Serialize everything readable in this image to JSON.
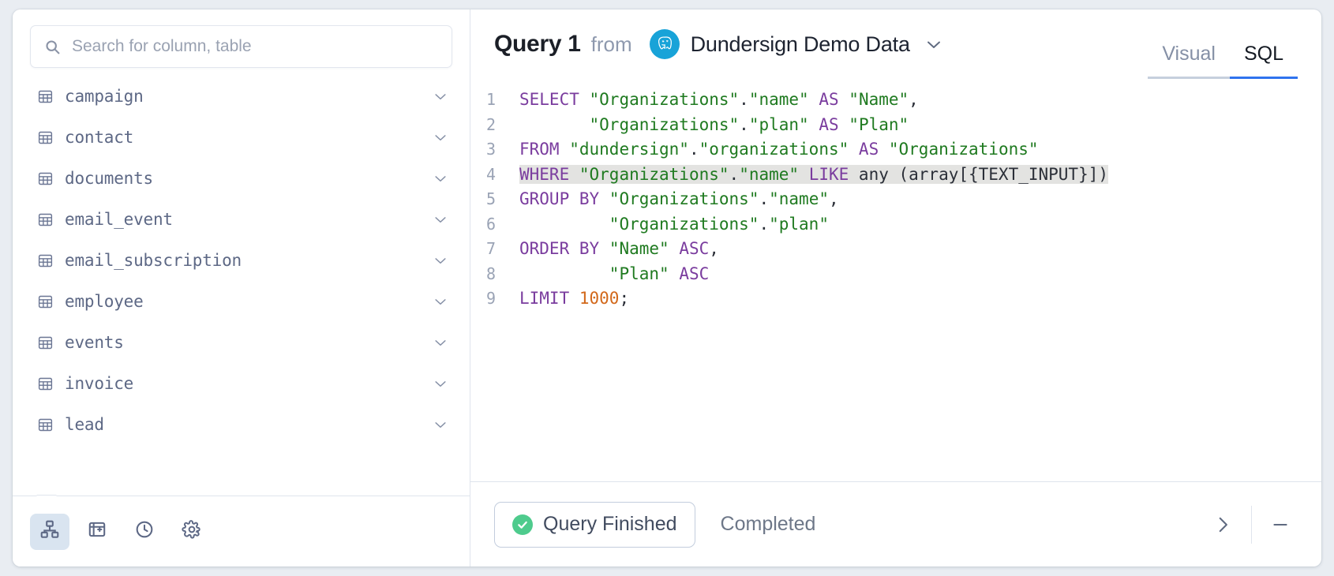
{
  "sidebar": {
    "search": {
      "placeholder": "Search for column, table",
      "value": "",
      "icon": "search-icon"
    },
    "tables": [
      {
        "name": "campaign",
        "icon": "table-icon",
        "expand_icon": "chevron-down-icon"
      },
      {
        "name": "contact",
        "icon": "table-icon",
        "expand_icon": "chevron-down-icon"
      },
      {
        "name": "documents",
        "icon": "table-icon",
        "expand_icon": "chevron-down-icon"
      },
      {
        "name": "email_event",
        "icon": "table-icon",
        "expand_icon": "chevron-down-icon"
      },
      {
        "name": "email_subscription",
        "icon": "table-icon",
        "expand_icon": "chevron-down-icon"
      },
      {
        "name": "employee",
        "icon": "table-icon",
        "expand_icon": "chevron-down-icon"
      },
      {
        "name": "events",
        "icon": "table-icon",
        "expand_icon": "chevron-down-icon"
      },
      {
        "name": "invoice",
        "icon": "table-icon",
        "expand_icon": "chevron-down-icon"
      },
      {
        "name": "lead",
        "icon": "table-icon",
        "expand_icon": "chevron-down-icon"
      }
    ],
    "footer_buttons": [
      {
        "icon": "data-model-icon",
        "active": true
      },
      {
        "icon": "notebook-icon",
        "active": false
      },
      {
        "icon": "history-clock-icon",
        "active": false
      },
      {
        "icon": "gear-icon",
        "active": false
      }
    ]
  },
  "header": {
    "query_title": "Query 1",
    "from_label": "from",
    "database_name": "Dundersign Demo Data",
    "database_logo": "postgresql-elephant-icon",
    "database_caret": "chevron-down-icon",
    "tabs": [
      {
        "label": "Visual",
        "active": false
      },
      {
        "label": "SQL",
        "active": true
      }
    ]
  },
  "editor": {
    "lines": [
      {
        "number": "1",
        "highlight": false,
        "tokens": [
          {
            "t": "SELECT",
            "c": "kw"
          },
          {
            "t": " ",
            "c": "pn"
          },
          {
            "t": "\"Organizations\"",
            "c": "str"
          },
          {
            "t": ".",
            "c": "pn"
          },
          {
            "t": "\"name\"",
            "c": "str"
          },
          {
            "t": " ",
            "c": "pn"
          },
          {
            "t": "AS",
            "c": "kw"
          },
          {
            "t": " ",
            "c": "pn"
          },
          {
            "t": "\"Name\"",
            "c": "str"
          },
          {
            "t": ",",
            "c": "pn"
          }
        ]
      },
      {
        "number": "2",
        "highlight": false,
        "tokens": [
          {
            "t": "       ",
            "c": "pn"
          },
          {
            "t": "\"Organizations\"",
            "c": "str"
          },
          {
            "t": ".",
            "c": "pn"
          },
          {
            "t": "\"plan\"",
            "c": "str"
          },
          {
            "t": " ",
            "c": "pn"
          },
          {
            "t": "AS",
            "c": "kw"
          },
          {
            "t": " ",
            "c": "pn"
          },
          {
            "t": "\"Plan\"",
            "c": "str"
          }
        ]
      },
      {
        "number": "3",
        "highlight": false,
        "tokens": [
          {
            "t": "FROM",
            "c": "kw"
          },
          {
            "t": " ",
            "c": "pn"
          },
          {
            "t": "\"dundersign\"",
            "c": "str"
          },
          {
            "t": ".",
            "c": "pn"
          },
          {
            "t": "\"organizations\"",
            "c": "str"
          },
          {
            "t": " ",
            "c": "pn"
          },
          {
            "t": "AS",
            "c": "kw"
          },
          {
            "t": " ",
            "c": "pn"
          },
          {
            "t": "\"Organizations\"",
            "c": "str"
          }
        ]
      },
      {
        "number": "4",
        "highlight": true,
        "tokens": [
          {
            "t": "WHERE",
            "c": "kw"
          },
          {
            "t": " ",
            "c": "pn"
          },
          {
            "t": "\"Organizations\"",
            "c": "str"
          },
          {
            "t": ".",
            "c": "pn"
          },
          {
            "t": "\"name\"",
            "c": "str"
          },
          {
            "t": " ",
            "c": "pn"
          },
          {
            "t": "LIKE",
            "c": "kw"
          },
          {
            "t": " any (array[{TEXT_INPUT}])",
            "c": "pn"
          }
        ]
      },
      {
        "number": "5",
        "highlight": false,
        "tokens": [
          {
            "t": "GROUP BY",
            "c": "kw"
          },
          {
            "t": " ",
            "c": "pn"
          },
          {
            "t": "\"Organizations\"",
            "c": "str"
          },
          {
            "t": ".",
            "c": "pn"
          },
          {
            "t": "\"name\"",
            "c": "str"
          },
          {
            "t": ",",
            "c": "pn"
          }
        ]
      },
      {
        "number": "6",
        "highlight": false,
        "tokens": [
          {
            "t": "         ",
            "c": "pn"
          },
          {
            "t": "\"Organizations\"",
            "c": "str"
          },
          {
            "t": ".",
            "c": "pn"
          },
          {
            "t": "\"plan\"",
            "c": "str"
          }
        ]
      },
      {
        "number": "7",
        "highlight": false,
        "tokens": [
          {
            "t": "ORDER BY",
            "c": "kw"
          },
          {
            "t": " ",
            "c": "pn"
          },
          {
            "t": "\"Name\"",
            "c": "str"
          },
          {
            "t": " ",
            "c": "pn"
          },
          {
            "t": "ASC",
            "c": "kw"
          },
          {
            "t": ",",
            "c": "pn"
          }
        ]
      },
      {
        "number": "8",
        "highlight": false,
        "tokens": [
          {
            "t": "         ",
            "c": "pn"
          },
          {
            "t": "\"Plan\"",
            "c": "str"
          },
          {
            "t": " ",
            "c": "pn"
          },
          {
            "t": "ASC",
            "c": "kw"
          }
        ]
      },
      {
        "number": "9",
        "highlight": false,
        "tokens": [
          {
            "t": "LIMIT",
            "c": "kw"
          },
          {
            "t": " ",
            "c": "pn"
          },
          {
            "t": "1000",
            "c": "num"
          },
          {
            "t": ";",
            "c": "pn"
          }
        ]
      }
    ]
  },
  "status": {
    "chip_label": "Query Finished",
    "chip_icon": "check-circle-icon",
    "detail": "Completed",
    "expand_icon": "chevron-right-icon",
    "minimize_icon": "minimize-dash-icon"
  },
  "colors": {
    "accent_blue": "#2f73ee",
    "success_green": "#4ecb8d",
    "postgres_cyan": "#18a3d8",
    "keyword_purple": "#7a3c9e",
    "string_green": "#1f7a20",
    "number_orange": "#d2681a",
    "highlight_gray": "#e3e3e1"
  }
}
